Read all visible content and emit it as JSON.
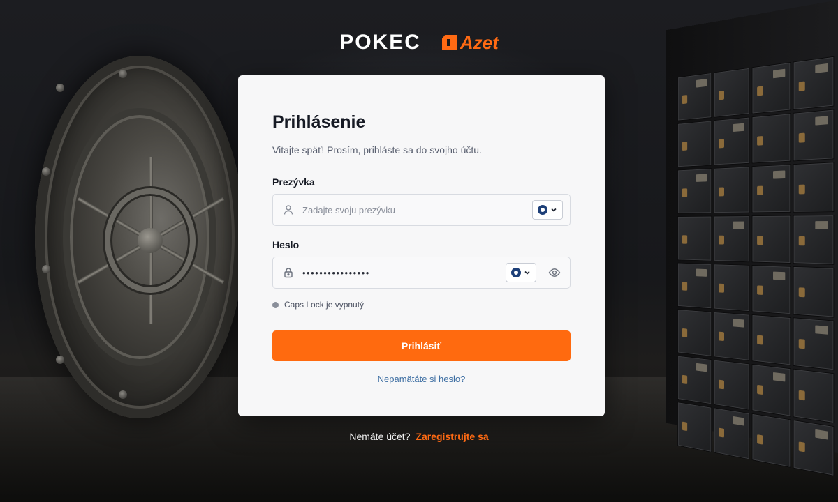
{
  "header": {
    "logo_pokec": "POKEC",
    "logo_azet": "Azet"
  },
  "login": {
    "title": "Prihlásenie",
    "subtitle": "Vitajte späť! Prosím, prihláste sa do svojho účtu.",
    "username": {
      "label": "Prezývka",
      "placeholder": "Zadajte svoju prezývku",
      "value": "",
      "icon": "user-icon"
    },
    "password": {
      "label": "Heslo",
      "masked_value": "••••••••••••••••",
      "icon": "lock-icon",
      "toggle_icon": "eye-icon"
    },
    "password_manager_icon": "password-manager-icon",
    "caps_lock_status": "Caps Lock je vypnutý",
    "submit_label": "Prihlásiť",
    "forgot_link": "Nepamätáte si heslo?"
  },
  "footer": {
    "no_account_text": "Nemáte účet?",
    "register_link": "Zaregistrujte sa"
  },
  "colors": {
    "accent": "#ff6a0f",
    "link": "#3e6fa3",
    "card_bg": "#f7f7f8",
    "title": "#161a24"
  }
}
